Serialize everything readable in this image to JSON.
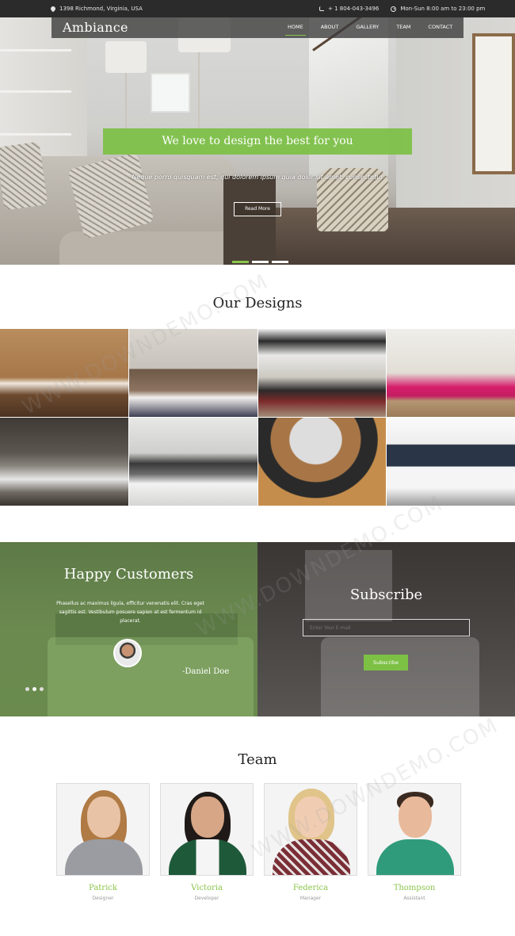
{
  "topbar": {
    "address": "1398 Richmond, Virginia, USA",
    "phone": "+ 1 804-043-3496",
    "hours": "Mon-Sun 8:00 am to 23:00 pm"
  },
  "nav": {
    "brand": "Ambiance",
    "items": [
      "HOME",
      "ABOUT",
      "GALLERY",
      "TEAM",
      "CONTACT"
    ],
    "active": "HOME"
  },
  "hero": {
    "headline": "We love to design the best for you",
    "tagline": "Neque porro quisquam est, qui dolorem ipsum quia dolor sit amet, consectetur",
    "button": "Read More",
    "slides": 3,
    "active_slide": 1
  },
  "designs": {
    "title": "Our Designs"
  },
  "testimonials": {
    "title": "Happy Customers",
    "quote": "Phasellus ac maximus ligula, efficitur venenatis elit. Cras eget sagittis est. Vestibulum posuere sapien at est fermentum id placerat.",
    "author": "-Daniel Doe",
    "slides": 3,
    "active_slide": 2
  },
  "subscribe": {
    "title": "Subscribe",
    "placeholder": "Enter Your E-mail",
    "button": "Subscribe"
  },
  "team": {
    "title": "Team",
    "members": [
      {
        "name": "Patrick",
        "role": "Designer"
      },
      {
        "name": "Victoria",
        "role": "Developer"
      },
      {
        "name": "Federica",
        "role": "Manager"
      },
      {
        "name": "Thompson",
        "role": "Assistant"
      }
    ]
  },
  "watermark": "WWW.DOWNDEMO.COM",
  "colors": {
    "accent": "#7cc044",
    "topbar": "#2b2b2b",
    "testimonials_bg": "#6a8b4d"
  }
}
